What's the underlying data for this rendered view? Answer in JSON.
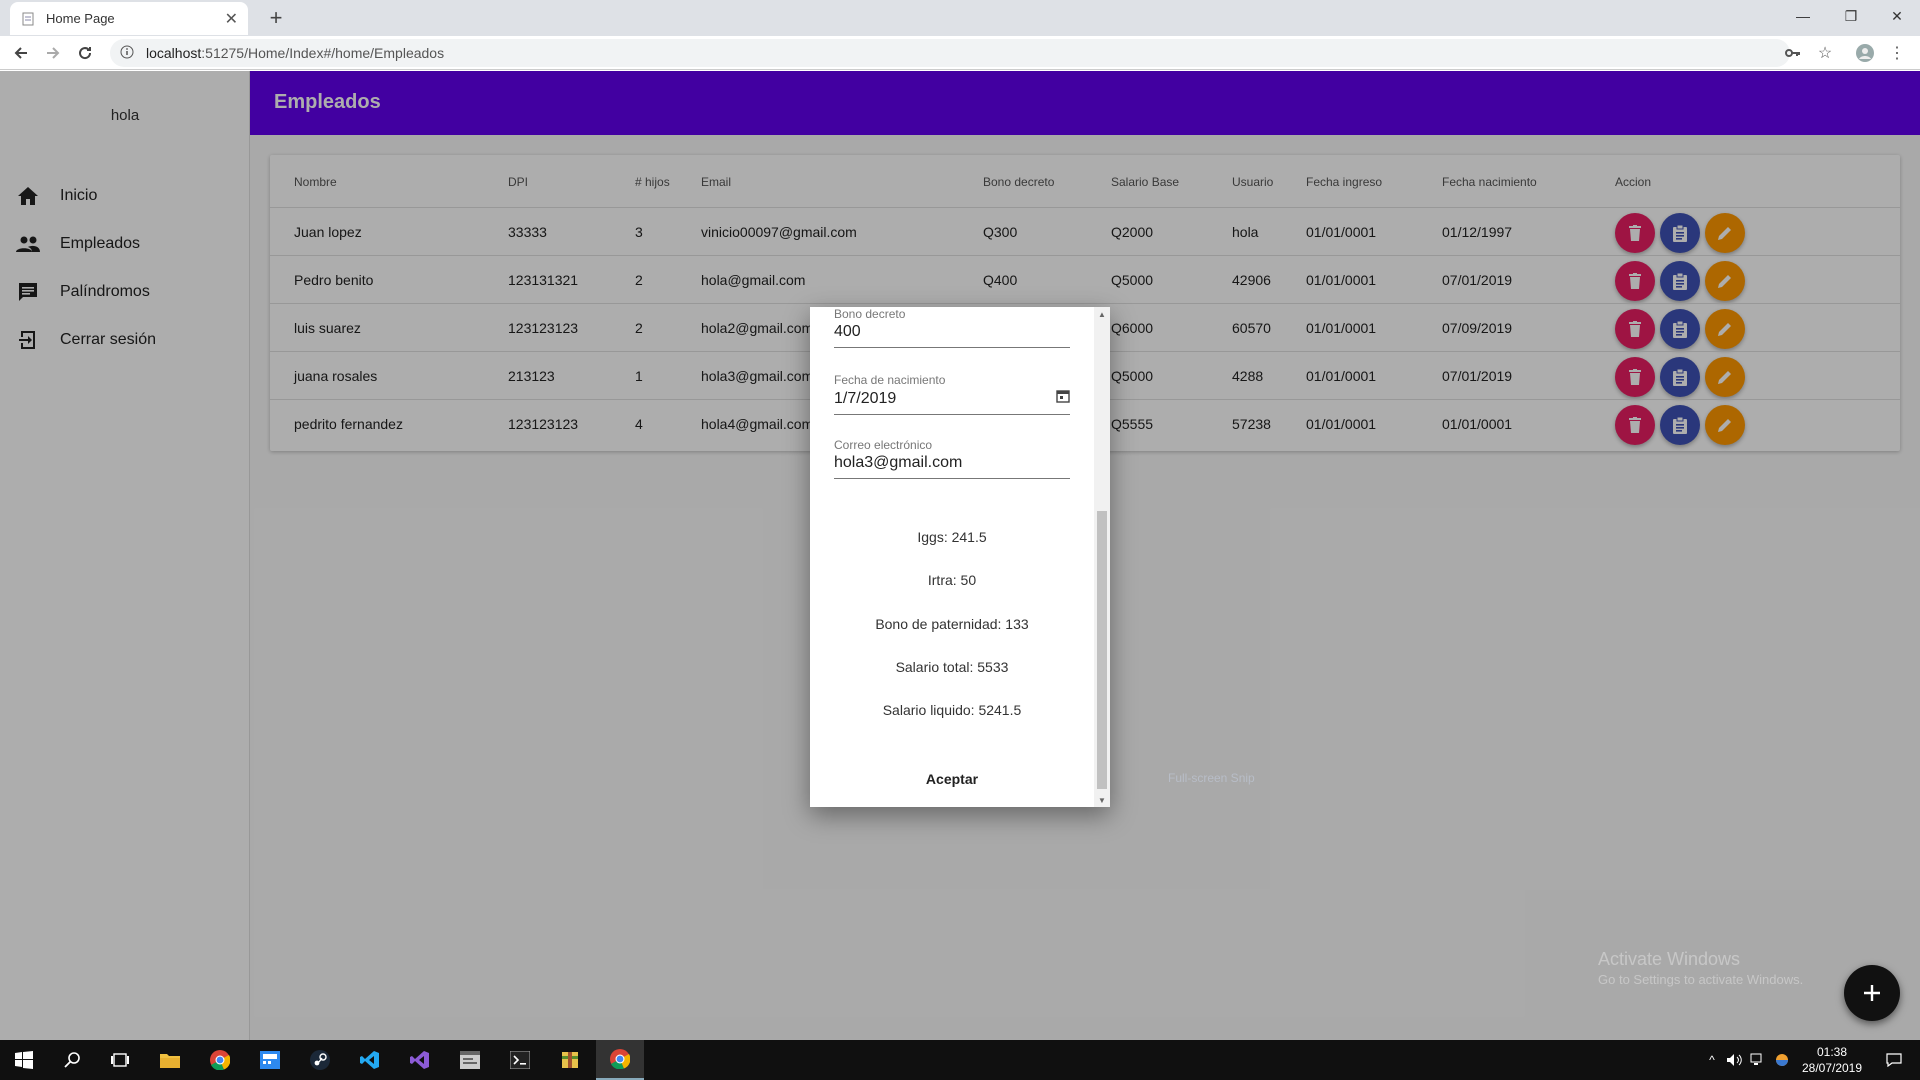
{
  "browser": {
    "tab_title": "Home Page",
    "new_tab": "+",
    "url_host": "localhost",
    "url_rest": ":51275/Home/Index#/home/Empleados"
  },
  "sidebar": {
    "user": "hola",
    "items": [
      {
        "label": "Inicio",
        "icon": "home-icon"
      },
      {
        "label": "Empleados",
        "icon": "people-icon"
      },
      {
        "label": "Palíndromos",
        "icon": "chat-icon"
      },
      {
        "label": "Cerrar sesión",
        "icon": "logout-icon"
      }
    ]
  },
  "appbar": {
    "title": "Empleados"
  },
  "table": {
    "headers": [
      "Nombre",
      "DPI",
      "# hijos",
      "Email",
      "Bono decreto",
      "Salario Base",
      "Usuario",
      "Fecha ingreso",
      "Fecha nacimiento",
      "Accion"
    ],
    "rows": [
      [
        "Juan lopez",
        "33333",
        "3",
        "vinicio00097@gmail.com",
        "Q300",
        "Q2000",
        "hola",
        "01/01/0001",
        "01/12/1997"
      ],
      [
        "Pedro benito",
        "123131321",
        "2",
        "hola@gmail.com",
        "Q400",
        "Q5000",
        "42906",
        "01/01/0001",
        "07/01/2019"
      ],
      [
        "luis suarez",
        "123123123",
        "2",
        "hola2@gmail.com",
        "",
        "Q6000",
        "60570",
        "01/01/0001",
        "07/09/2019"
      ],
      [
        "juana rosales",
        "213123",
        "1",
        "hola3@gmail.com",
        "",
        "Q5000",
        "4288",
        "01/01/0001",
        "07/01/2019"
      ],
      [
        "pedrito fernandez",
        "123123123",
        "4",
        "hola4@gmail.com",
        "",
        "Q5555",
        "57238",
        "01/01/0001",
        "01/01/0001"
      ]
    ]
  },
  "dialog": {
    "fields": [
      {
        "label": "Bono decreto",
        "value": "400"
      },
      {
        "label": "Fecha de nacimiento",
        "value": "1/7/2019"
      },
      {
        "label": "Correo electrónico",
        "value": "hola3@gmail.com"
      }
    ],
    "stats": [
      "Iggs: 241.5",
      "Irtra: 50",
      "Bono de paternidad: 133",
      "Salario total: 5533",
      "Salario liquido: 5241.5"
    ],
    "accept_label": "Aceptar"
  },
  "watermark": {
    "line1": "Activate Windows",
    "line2": "Go to Settings to activate Windows."
  },
  "snip_label": "Full-screen Snip",
  "fab_label": "+",
  "clock": {
    "time": "01:38",
    "date": "28/07/2019"
  },
  "colors": {
    "appbar": "#6200ee",
    "delete": "#e91e63",
    "detail": "#3f51b5",
    "edit": "#ff9800"
  }
}
